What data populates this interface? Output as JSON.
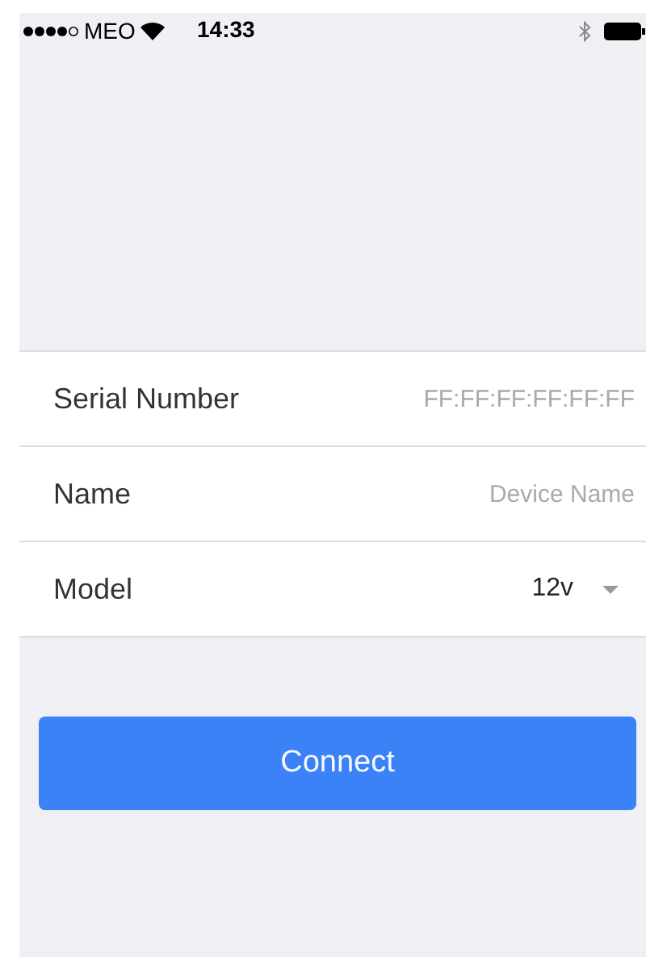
{
  "status_bar": {
    "carrier": "MEO",
    "time": "14:33"
  },
  "form": [
    {
      "kind": "text",
      "label": "Serial Number",
      "placeholder": "FF:FF:FF:FF:FF:FF"
    },
    {
      "kind": "text",
      "label": "Name",
      "placeholder": "Device Name"
    },
    {
      "kind": "select",
      "label": "Model",
      "value": "12v"
    }
  ],
  "button": {
    "label": "Connect"
  }
}
